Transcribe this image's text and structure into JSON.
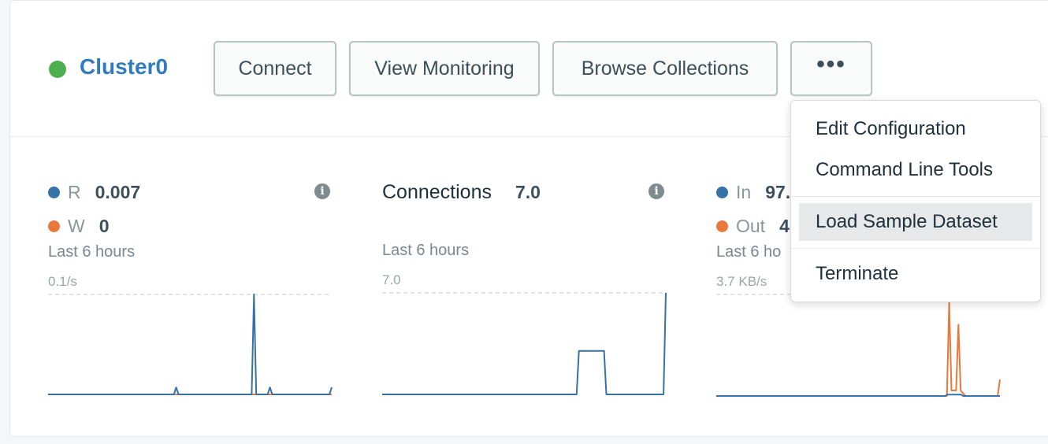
{
  "cluster": {
    "name": "Cluster0",
    "status_color": "#4caf50",
    "name_color": "#2f7bbd"
  },
  "buttons": {
    "connect": "Connect",
    "view_monitoring": "View Monitoring",
    "browse_collections": "Browse Collections",
    "more": "•••"
  },
  "colors": {
    "blue": "#3572a5",
    "orange": "#e8793a",
    "grid": "#d7dcde"
  },
  "panels": {
    "ops": {
      "r_label": "R",
      "r_value": "0.007",
      "w_label": "W",
      "w_value": "0",
      "period": "Last 6 hours",
      "max_label": "0.1/s"
    },
    "connections": {
      "title": "Connections",
      "value": "7.0",
      "period": "Last 6 hours",
      "max_label": "7.0"
    },
    "network": {
      "in_label": "In",
      "in_value": "97.",
      "out_label": "Out",
      "out_value": "4",
      "period": "Last 6 ho",
      "max_label": "3.7 KB/s"
    }
  },
  "menu": {
    "items": [
      "Edit Configuration",
      "Command Line Tools",
      "Load Sample Dataset",
      "Terminate"
    ],
    "active_index": 2
  },
  "chart_data": [
    {
      "type": "line",
      "max": 0.1,
      "series": [
        {
          "name": "R",
          "color": "#3572a5",
          "values": [
            0,
            0,
            0,
            0,
            0,
            0,
            0,
            0,
            0,
            0,
            0,
            0,
            0,
            0,
            0,
            0,
            0,
            0,
            0,
            0,
            0,
            0,
            0,
            0,
            0,
            0,
            0,
            0,
            0,
            0,
            0,
            0,
            0,
            0,
            0,
            0,
            0,
            0,
            0,
            0,
            0,
            0,
            0,
            0,
            0,
            0,
            0,
            0,
            0,
            0,
            0,
            0,
            0,
            0,
            0,
            0,
            0.007,
            0,
            0,
            0,
            0,
            0,
            0,
            0,
            0,
            0,
            0,
            0,
            0,
            0,
            0,
            0,
            0,
            0,
            0,
            0,
            0,
            0,
            0,
            0,
            0,
            0,
            0,
            0,
            0,
            0,
            0,
            0,
            0,
            0,
            0.1,
            0,
            0,
            0,
            0,
            0,
            0,
            0.007,
            0,
            0,
            0,
            0,
            0,
            0,
            0,
            0,
            0,
            0,
            0,
            0,
            0,
            0,
            0,
            0,
            0,
            0,
            0,
            0,
            0,
            0,
            0,
            0,
            0,
            0,
            0.007
          ]
        },
        {
          "name": "W",
          "color": "#e8793a",
          "values": [
            0,
            0,
            0,
            0,
            0,
            0,
            0,
            0,
            0,
            0,
            0,
            0,
            0,
            0,
            0,
            0,
            0,
            0,
            0,
            0,
            0,
            0,
            0,
            0,
            0,
            0,
            0,
            0,
            0,
            0,
            0,
            0,
            0,
            0,
            0,
            0,
            0,
            0,
            0,
            0,
            0,
            0,
            0,
            0,
            0,
            0,
            0,
            0,
            0,
            0,
            0,
            0,
            0,
            0,
            0,
            0,
            0,
            0,
            0,
            0,
            0,
            0,
            0,
            0,
            0,
            0,
            0,
            0,
            0,
            0,
            0,
            0,
            0,
            0,
            0,
            0,
            0,
            0,
            0,
            0,
            0,
            0,
            0,
            0,
            0,
            0,
            0,
            0,
            0,
            0,
            0,
            0,
            0,
            0,
            0,
            0,
            0,
            0,
            0,
            0,
            0,
            0,
            0,
            0,
            0,
            0,
            0,
            0,
            0,
            0,
            0,
            0,
            0,
            0,
            0,
            0,
            0,
            0,
            0,
            0,
            0,
            0,
            0
          ]
        }
      ]
    },
    {
      "type": "line",
      "max": 7.0,
      "series": [
        {
          "name": "Connections",
          "color": "#3572a5",
          "values": [
            0,
            0,
            0,
            0,
            0,
            0,
            0,
            0,
            0,
            0,
            0,
            0,
            0,
            0,
            0,
            0,
            0,
            0,
            0,
            0,
            0,
            0,
            0,
            0,
            0,
            0,
            0,
            0,
            0,
            0,
            0,
            0,
            0,
            0,
            0,
            0,
            0,
            0,
            0,
            0,
            0,
            0,
            0,
            0,
            0,
            0,
            0,
            0,
            0,
            0,
            0,
            0,
            0,
            0,
            0,
            0,
            0,
            0,
            0,
            0,
            0,
            0,
            0,
            0,
            0,
            0,
            0,
            0,
            0,
            0,
            0,
            0,
            0,
            0,
            0,
            0,
            0,
            0,
            0,
            0,
            0,
            0,
            0,
            0,
            0,
            0,
            3,
            3,
            3,
            3,
            3,
            3,
            3,
            3,
            3,
            3,
            3,
            3,
            0,
            0,
            0,
            0,
            0,
            0,
            0,
            0,
            0,
            0,
            0,
            0,
            0,
            0,
            0,
            0,
            0,
            0,
            0,
            0,
            0,
            0,
            0,
            0,
            0,
            0,
            7
          ]
        }
      ]
    },
    {
      "type": "line",
      "max": 3.7,
      "series": [
        {
          "name": "In",
          "color": "#3572a5",
          "values": [
            0,
            0,
            0,
            0,
            0,
            0,
            0,
            0,
            0,
            0,
            0,
            0,
            0,
            0,
            0,
            0,
            0,
            0,
            0,
            0,
            0,
            0,
            0,
            0,
            0,
            0,
            0,
            0,
            0,
            0,
            0,
            0,
            0,
            0,
            0,
            0,
            0,
            0,
            0,
            0,
            0,
            0,
            0,
            0,
            0,
            0,
            0,
            0,
            0,
            0,
            0,
            0,
            0,
            0,
            0,
            0,
            0,
            0,
            0,
            0,
            0,
            0,
            0,
            0,
            0,
            0,
            0,
            0,
            0,
            0,
            0,
            0,
            0,
            0,
            0,
            0,
            0,
            0,
            0,
            0,
            0,
            0,
            0,
            0,
            0,
            0,
            0,
            0,
            0,
            0,
            0,
            0,
            0,
            0,
            0,
            0,
            0,
            0,
            0,
            0,
            0,
            0.05,
            0.05,
            0.05,
            0.05,
            0.05,
            0.05,
            0.05,
            0,
            0,
            0,
            0,
            0,
            0,
            0,
            0,
            0,
            0,
            0,
            0,
            0,
            0,
            0,
            0,
            0
          ]
        },
        {
          "name": "Out",
          "color": "#e8793a",
          "values": [
            0,
            0,
            0,
            0,
            0,
            0,
            0,
            0,
            0,
            0,
            0,
            0,
            0,
            0,
            0,
            0,
            0,
            0,
            0,
            0,
            0,
            0,
            0,
            0,
            0,
            0,
            0,
            0,
            0,
            0,
            0,
            0,
            0,
            0,
            0,
            0,
            0,
            0,
            0,
            0,
            0,
            0,
            0,
            0,
            0,
            0,
            0,
            0,
            0,
            0,
            0,
            0,
            0,
            0,
            0,
            0,
            0,
            0,
            0,
            0,
            0,
            0,
            0,
            0,
            0,
            0,
            0,
            0,
            0,
            0,
            0,
            0,
            0,
            0,
            0,
            0,
            0,
            0,
            0,
            0,
            0,
            0,
            0,
            0,
            0,
            0,
            0,
            0,
            0,
            0,
            0,
            0,
            0,
            0,
            0,
            0,
            0,
            0,
            0,
            0,
            0,
            3.4,
            0.2,
            0.2,
            0.2,
            2.6,
            0.2,
            0.1,
            0,
            0,
            0,
            0,
            0,
            0,
            0,
            0,
            0,
            0,
            0,
            0,
            0,
            0,
            0,
            0.6
          ]
        }
      ]
    }
  ]
}
